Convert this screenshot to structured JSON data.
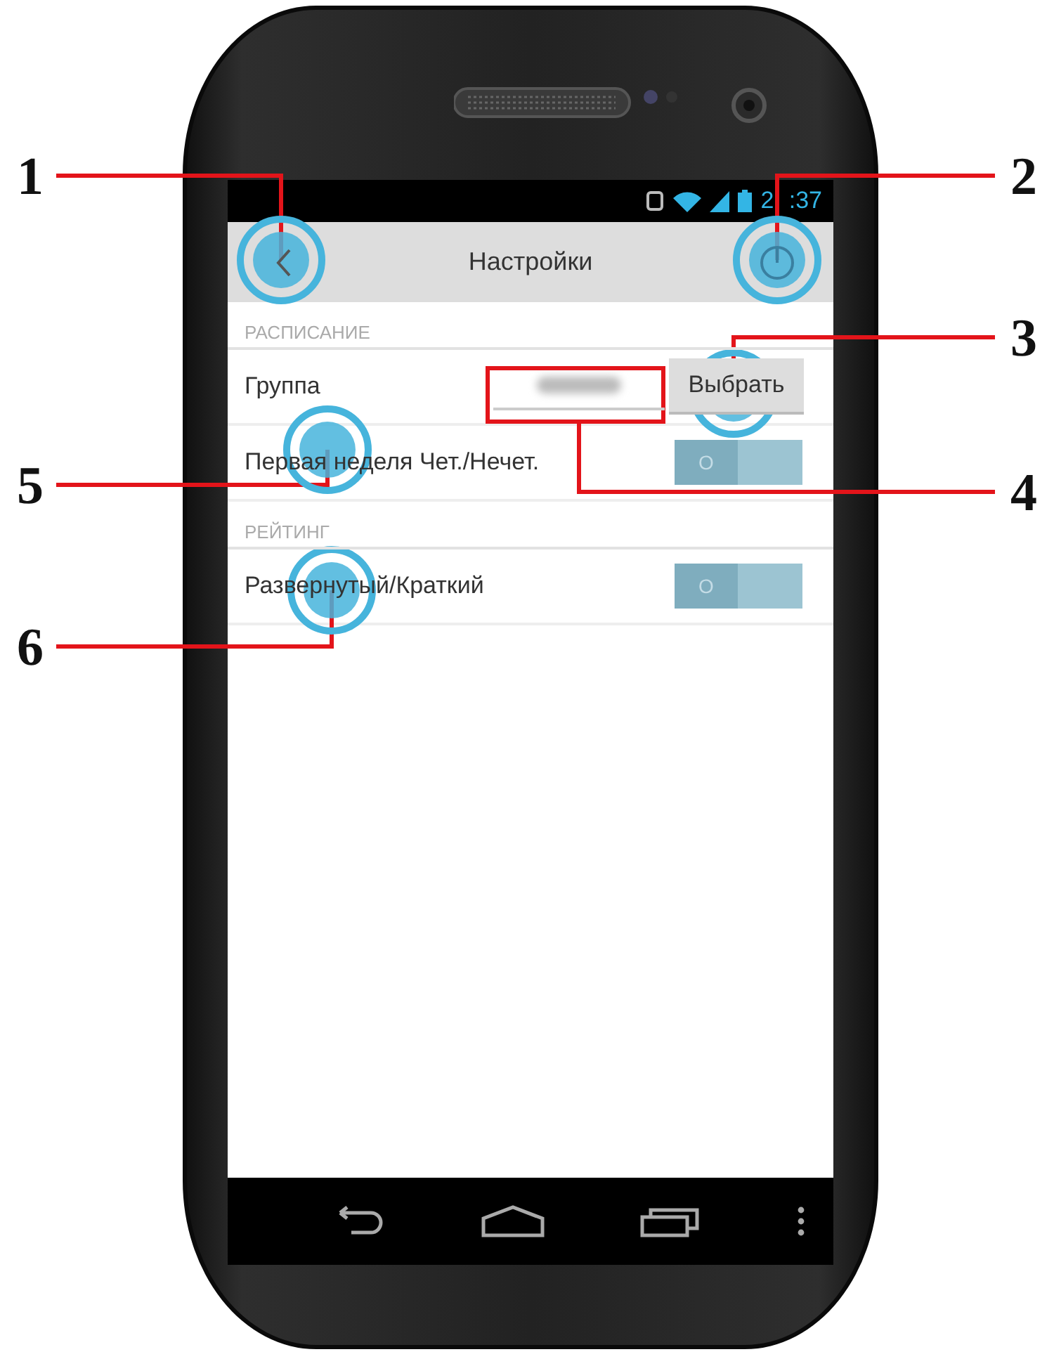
{
  "status_bar": {
    "time": "2 :37"
  },
  "app_bar": {
    "title": "Настройки"
  },
  "sections": [
    {
      "header": "РАСПИСАНИЕ",
      "rows": [
        {
          "kind": "field",
          "label": "Группа",
          "button": "Выбрать"
        },
        {
          "kind": "toggle",
          "label": "Первая неделя Чет./Нечет.",
          "on": false,
          "thumb": "O"
        }
      ]
    },
    {
      "header": "РЕЙТИНГ",
      "rows": [
        {
          "kind": "toggle",
          "label": "Развернутый/Краткий",
          "on": false,
          "thumb": "O"
        }
      ]
    }
  ],
  "callouts": [
    {
      "number": "1"
    },
    {
      "number": "2"
    },
    {
      "number": "3"
    },
    {
      "number": "5"
    },
    {
      "number": "4"
    },
    {
      "number": "6"
    }
  ]
}
